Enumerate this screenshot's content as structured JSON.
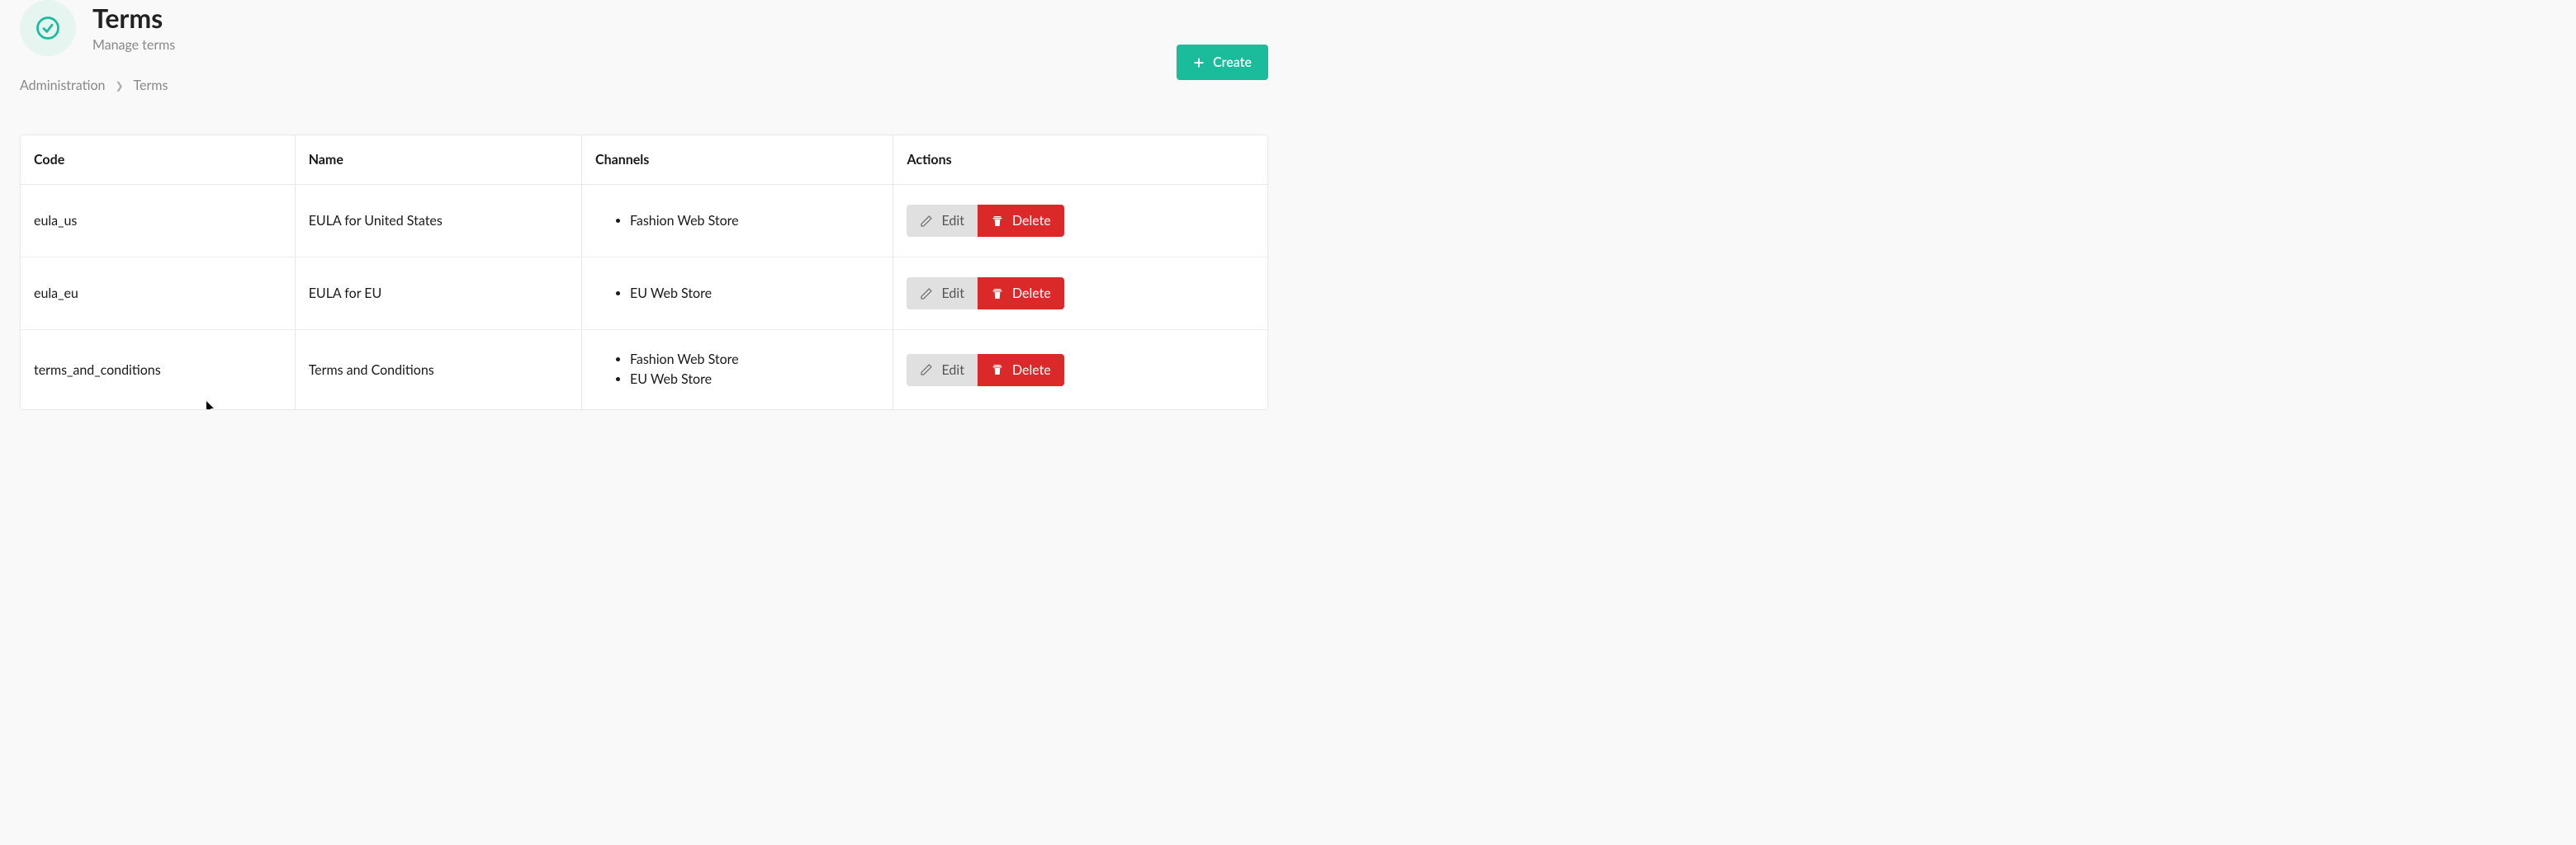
{
  "header": {
    "title": "Terms",
    "subtitle": "Manage terms",
    "create_label": "Create"
  },
  "breadcrumb": {
    "administration": "Administration",
    "current": "Terms"
  },
  "columns": {
    "code": "Code",
    "name": "Name",
    "channels": "Channels",
    "actions": "Actions"
  },
  "buttons": {
    "edit": "Edit",
    "delete": "Delete"
  },
  "rows": [
    {
      "code": "eula_us",
      "name": "EULA for United States",
      "channels": [
        "Fashion Web Store"
      ]
    },
    {
      "code": "eula_eu",
      "name": "EULA for EU",
      "channels": [
        "EU Web Store"
      ]
    },
    {
      "code": "terms_and_conditions",
      "name": "Terms and Conditions",
      "channels": [
        "Fashion Web Store",
        "EU Web Store"
      ]
    }
  ]
}
